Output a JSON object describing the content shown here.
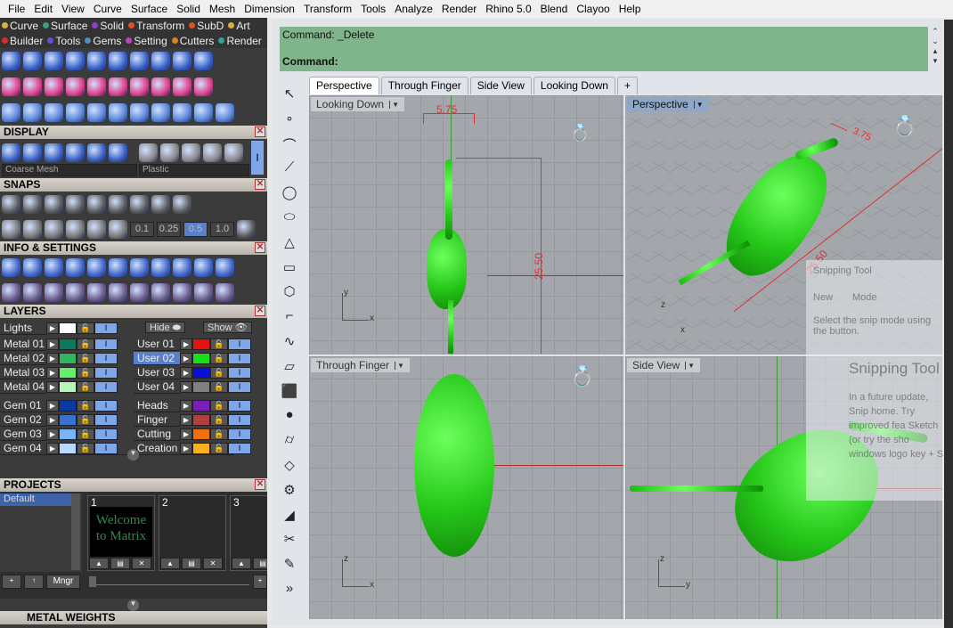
{
  "menu": [
    "File",
    "Edit",
    "View",
    "Curve",
    "Surface",
    "Solid",
    "Mesh",
    "Dimension",
    "Transform",
    "Tools",
    "Analyze",
    "Render",
    "Rhino 5.0",
    "Blend",
    "Clayoo",
    "Help"
  ],
  "matrix_tabs_row1": [
    {
      "label": "Curve",
      "color": "#d8b040"
    },
    {
      "label": "Surface",
      "color": "#3aa07a"
    },
    {
      "label": "Solid",
      "color": "#8a40c8"
    },
    {
      "label": "Transform",
      "color": "#e05020"
    },
    {
      "label": "SubD",
      "color": "#e05020"
    },
    {
      "label": "Art",
      "color": "#d8b040"
    }
  ],
  "matrix_tabs_row2": [
    {
      "label": "Builder",
      "color": "#d03030"
    },
    {
      "label": "Tools",
      "color": "#6a50d0"
    },
    {
      "label": "Gems",
      "color": "#4a90c0"
    },
    {
      "label": "Setting",
      "color": "#c040c0"
    },
    {
      "label": "Cutters",
      "color": "#e08020"
    },
    {
      "label": "Render",
      "color": "#30a0a0"
    }
  ],
  "toolbar_rows": [
    {
      "color": "#3b62c8",
      "icons": [
        "circle-icon",
        "curve-helix-icon",
        "ring-icon",
        "ring-profile-icon",
        "curve-4-icon",
        "prong-icon",
        "gem-setting-icon",
        "shield-icon",
        "ring-book-icon",
        "signet-book-icon"
      ]
    },
    {
      "color": "#e0408a",
      "icons": [
        "point-add-icon",
        "point-add-plus-icon",
        "point-remove-icon",
        "arc-points-icon",
        "rotate-center-icon",
        "link-icon",
        "purple-texture-icon",
        "check-icon",
        "explode-grid-icon",
        "render-globe-icon"
      ]
    },
    {
      "color": "#5b86d8",
      "icons": [
        "boxes-icon",
        "arc-icon",
        "fillet-curve-icon",
        "split-figure-icon",
        "move-arrows-icon",
        "rotate-corner-icon",
        "burst-icon",
        "link-frame-icon",
        "unlink-frame-icon",
        "cut-scissors-icon",
        "torus-icon"
      ]
    }
  ],
  "display": {
    "title": "DISPLAY",
    "icons": [
      "grid-display-icon",
      "cross-axis-icon",
      "blue-sphere-icon",
      "purple-sphere-icon",
      "render-earth-icon",
      "green-grid-icon"
    ],
    "materials": [
      "matte-sphere-icon",
      "chrome-sphere-icon",
      "glossy-sphere-icon",
      "glass-sphere-icon",
      "gold-sphere-icon"
    ],
    "mesh_select": "Coarse Mesh",
    "material_select": "Plastic"
  },
  "snaps": {
    "title": "SNAPS",
    "icons": [
      "snap-end-icon",
      "snap-near-icon",
      "snap-point-icon",
      "snap-mid-icon",
      "snap-perp-icon",
      "snap-quad-icon",
      "snap-center-icon",
      "snap-tan-icon",
      "snap-line-icon"
    ],
    "row2": [
      "snap-grid-icon",
      "snap-box-icon",
      "snap-line-diag-icon",
      "snap-45-icon",
      "snap-plane-icon",
      "snap-project-icon"
    ],
    "values": [
      "0.1",
      "0.25",
      "0.5",
      "1.0"
    ],
    "active_value": "0.5"
  },
  "info": {
    "title": "INFO & SETTINGS",
    "icons": [
      "settings-gears-icon",
      "wrench-icon",
      "layers-stack-icon",
      "windows-icon",
      "scroll-icon",
      "notepad-icon",
      "purple-box-icon",
      "broom-icon",
      "play-frame-icon",
      "record-frame-icon",
      "delete-frame-icon"
    ],
    "row2": [
      "four-view-icon",
      "monitor-icon",
      "cube-select-icon",
      "book-icon",
      "filter-icon",
      "select-check-icon",
      "document-icon",
      "gumball-icon",
      "gumball-select-icon",
      "gumball-red-icon",
      "gumball-cyan-icon"
    ]
  },
  "layers": {
    "title": "LAYERS",
    "lights": {
      "name": "Lights",
      "color": "#ffffff"
    },
    "hide": "Hide",
    "show": "Show",
    "left": [
      {
        "name": "Metal 01",
        "color": "#0a7a5a"
      },
      {
        "name": "Metal 02",
        "color": "#2db860"
      },
      {
        "name": "Metal 03",
        "color": "#66ee66"
      },
      {
        "name": "Metal 04",
        "color": "#b8f5b8"
      },
      {
        "name": "Gem 01",
        "color": "#0a3aa0"
      },
      {
        "name": "Gem 02",
        "color": "#3a70d0"
      },
      {
        "name": "Gem 03",
        "color": "#7ab4f5"
      },
      {
        "name": "Gem 04",
        "color": "#b8d8ff"
      }
    ],
    "right": [
      {
        "name": "User 01",
        "color": "#e81010"
      },
      {
        "name": "User 02",
        "color": "#18e018",
        "selected": true
      },
      {
        "name": "User 03",
        "color": "#0a10d8"
      },
      {
        "name": "User 04",
        "color": "#808080"
      },
      {
        "name": "Heads",
        "color": "#7a20b8"
      },
      {
        "name": "Finger",
        "color": "#b04040"
      },
      {
        "name": "Cutting",
        "color": "#f07010"
      },
      {
        "name": "Creation",
        "color": "#f8b020"
      }
    ]
  },
  "projects": {
    "title": "PROJECTS",
    "list": [
      "Default"
    ],
    "slots": [
      {
        "num": "1",
        "thumb": "Welcome to Matrix"
      },
      {
        "num": "2",
        "thumb": ""
      },
      {
        "num": "3",
        "thumb": ""
      }
    ],
    "mngr": "Mngr"
  },
  "next_panel": "METAL WEIGHTS",
  "command": {
    "history": "Command: _Delete",
    "prompt": "Command:"
  },
  "viewport_tabs": [
    {
      "label": "Perspective",
      "active": true
    },
    {
      "label": "Through Finger"
    },
    {
      "label": "Side View"
    },
    {
      "label": "Looking Down"
    }
  ],
  "left_tools": [
    "select-arrow-icon",
    "point-icon",
    "polyline-icon",
    "curve-icon",
    "circle-tool-icon",
    "ellipse-icon",
    "triangle-icon",
    "rectangle-icon",
    "polygon-icon",
    "fillet-icon",
    "curve-points-icon",
    "surface-icon",
    "box-icon",
    "spheres-icon",
    "cylinder-icon",
    "patch-icon",
    "gear-icon",
    "analyze-icon",
    "cut-icon",
    "edit-tool-icon",
    "more-icon"
  ],
  "viewports": [
    {
      "label": "Looking Down",
      "dim1": "5.75",
      "dim2": "25.50",
      "ax1": "y",
      "ax2": "x"
    },
    {
      "label": "Perspective",
      "active": true,
      "dim1": "3.75",
      "dim2": "25.50",
      "ax1": "z",
      "ax2": "x"
    },
    {
      "label": "Through Finger",
      "ax1": "z",
      "ax2": "x"
    },
    {
      "label": "Side View",
      "ax1": "z",
      "ax2": "y"
    }
  ],
  "snipping_tool": {
    "title": "Snipping Tool",
    "new": "New",
    "mode": "Mode",
    "hint": "Select the snip mode using the button.",
    "notice": "Snipping Tool is m",
    "body": "In a future update, Snip home. Try improved fea Sketch (or try the sho windows logo key + S"
  }
}
